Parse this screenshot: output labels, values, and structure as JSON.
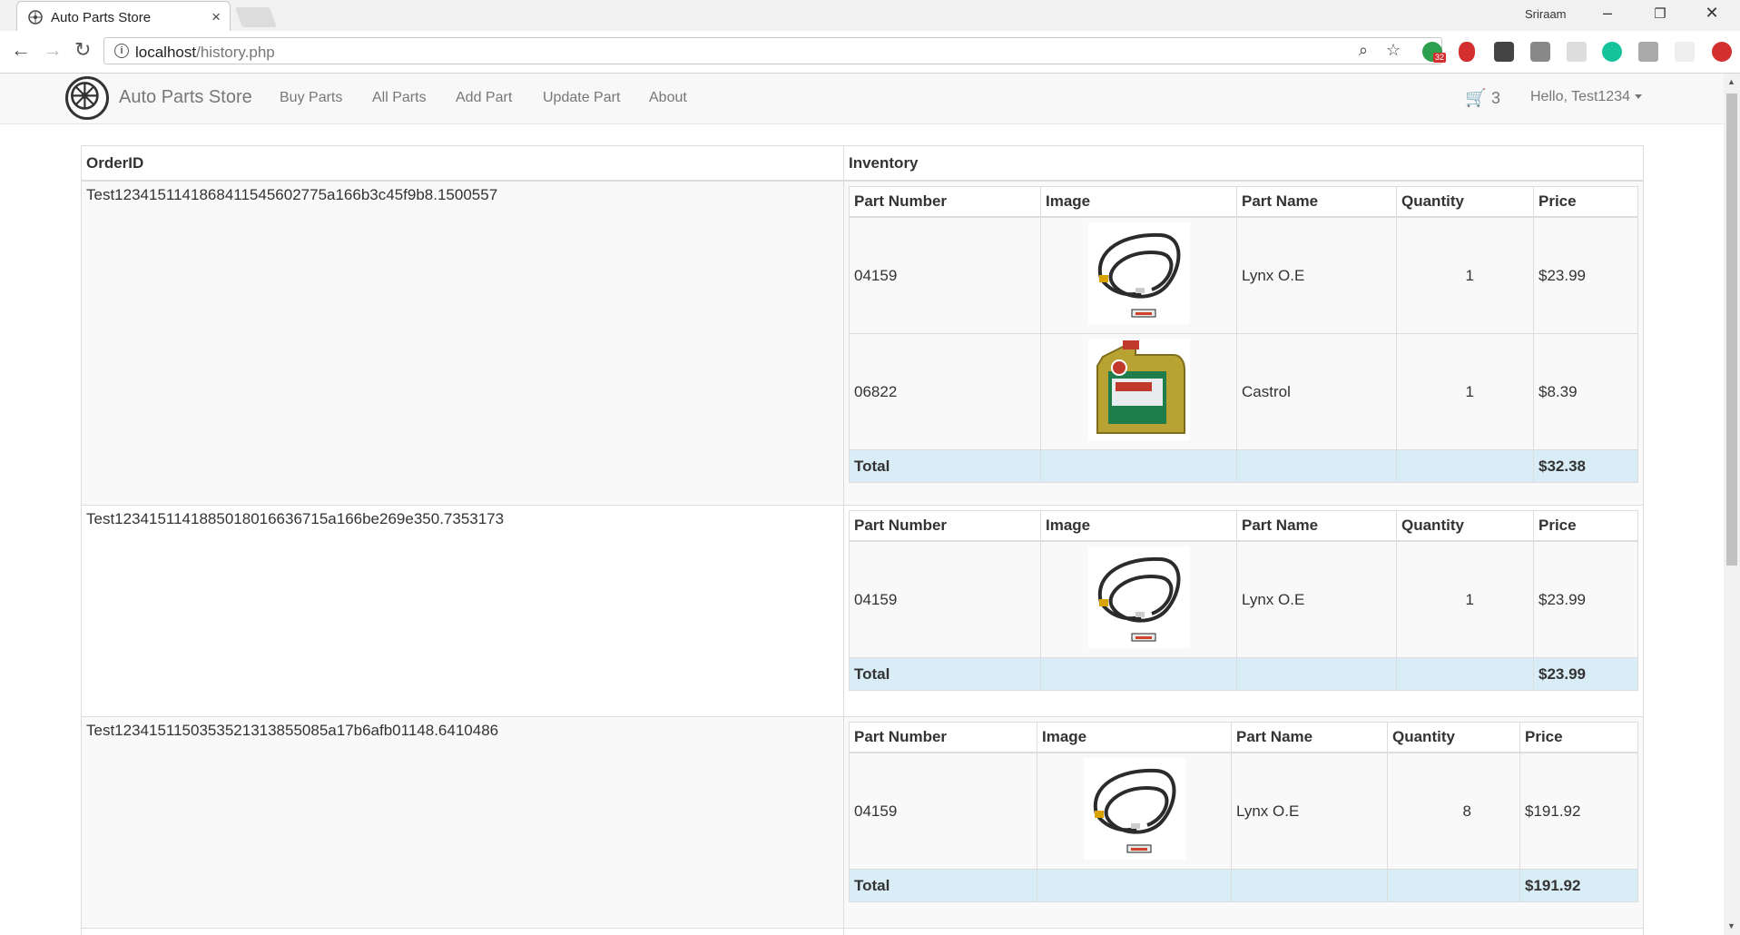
{
  "browser": {
    "tab_title": "Auto Parts Store",
    "profile_name": "Sriraam",
    "url_host": "localhost",
    "url_path": "/history.php",
    "extension_badge": "32"
  },
  "navbar": {
    "brand": "Auto Parts Store",
    "links": [
      "Buy Parts",
      "All Parts",
      "Add Part",
      "Update Part",
      "About"
    ],
    "cart_count": "3",
    "user_greeting": "Hello, Test1234"
  },
  "history": {
    "headers": {
      "order_id": "OrderID",
      "inventory": "Inventory"
    },
    "columns": [
      "Part Number",
      "Image",
      "Part Name",
      "Quantity",
      "Price"
    ],
    "total_label": "Total",
    "orders": [
      {
        "order_id": "Test1234151141868411545602775a166b3c45f9b8.1500557",
        "items": [
          {
            "part_number": "04159",
            "image": "battery-cable-image",
            "part_name": "Lynx O.E",
            "quantity": "1",
            "price": "$23.99"
          },
          {
            "part_number": "06822",
            "image": "oil-can-image",
            "part_name": "Castrol",
            "quantity": "1",
            "price": "$8.39"
          }
        ],
        "total": "$32.38"
      },
      {
        "order_id": "Test1234151141885018016636715a166be269e350.7353173",
        "items": [
          {
            "part_number": "04159",
            "image": "battery-cable-image",
            "part_name": "Lynx O.E",
            "quantity": "1",
            "price": "$23.99"
          }
        ],
        "total": "$23.99"
      },
      {
        "order_id": "Test1234151150353521313855085a17b6afb01148.6410486",
        "items": [
          {
            "part_number": "04159",
            "image": "battery-cable-image",
            "part_name": "Lynx O.E",
            "quantity": "8",
            "price": "$191.92"
          }
        ],
        "total": "$191.92"
      }
    ]
  },
  "colors": {
    "total_row": "#d9edf7",
    "navbar_bg": "#f8f8f8",
    "striped_row": "#f9f9f9"
  }
}
